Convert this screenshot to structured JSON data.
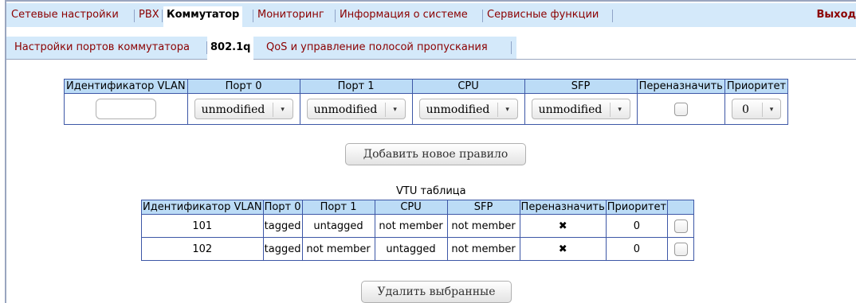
{
  "nav": {
    "tabs": [
      {
        "label": "Сетевые настройки"
      },
      {
        "label": "PBX"
      },
      {
        "label": "Коммутатор"
      },
      {
        "label": "Мониторинг"
      },
      {
        "label": "Информация о системе"
      },
      {
        "label": "Сервисные функции"
      }
    ],
    "logout": "Выход",
    "active_tab": "Коммутатор"
  },
  "subnav": {
    "tabs": [
      {
        "label": "Настройки портов коммутатора"
      },
      {
        "label": "802.1q"
      },
      {
        "label": "QoS и управление полосой пропускания"
      }
    ],
    "active_tab": "802.1q"
  },
  "edit_table": {
    "headers": [
      "Идентификатор VLAN",
      "Порт 0",
      "Порт 1",
      "CPU",
      "SFP",
      "Переназначить",
      "Приоритет"
    ],
    "vlan_id_value": "",
    "port0": "unmodified",
    "port1": "unmodified",
    "cpu": "unmodified",
    "sfp": "unmodified",
    "reassign_checked": false,
    "priority": "0",
    "arrow": "▾"
  },
  "add_button": "Добавить новое правило",
  "vtu": {
    "caption": "VTU таблица",
    "headers": [
      "Идентификатор VLAN",
      "Порт 0",
      "Порт 1",
      "CPU",
      "SFP",
      "Переназначить",
      "Приоритет",
      ""
    ],
    "rows": [
      {
        "vlan": "101",
        "port0": "tagged",
        "port1": "untagged",
        "cpu": "not member",
        "sfp": "not member",
        "reassign": "✖",
        "priority": "0"
      },
      {
        "vlan": "102",
        "port0": "tagged",
        "port1": "not member",
        "cpu": "untagged",
        "sfp": "not member",
        "reassign": "✖",
        "priority": "0"
      }
    ]
  },
  "delete_button": "Удалить выбранные",
  "colors": {
    "tab_bar": "#d4e9fa",
    "header_bg": "#bcdcf6",
    "border": "#3d57a6",
    "link": "#8b0000"
  }
}
